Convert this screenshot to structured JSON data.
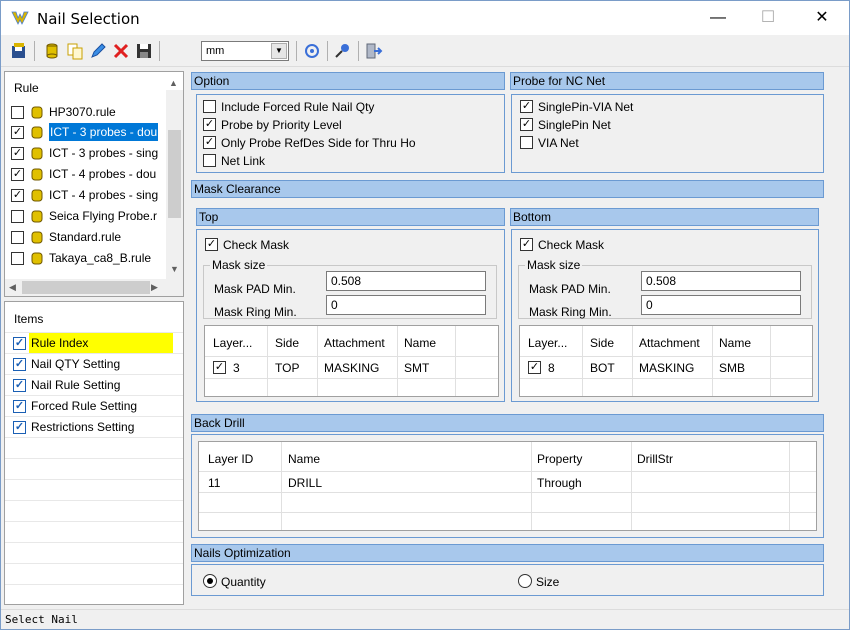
{
  "window": {
    "title": "Nail Selection",
    "minimize": "—",
    "maximize": "☐",
    "close": "✕"
  },
  "toolbar": {
    "unit_value": "mm"
  },
  "rule_panel": {
    "header": "Rule",
    "items": [
      {
        "label": "HP3070.rule",
        "checked": ""
      },
      {
        "label": "ICT - 3 probes - dou",
        "checked": "✓"
      },
      {
        "label": "ICT - 3 probes - sing",
        "checked": "✓"
      },
      {
        "label": "ICT - 4 probes - dou",
        "checked": "✓"
      },
      {
        "label": "ICT - 4 probes - sing",
        "checked": "✓"
      },
      {
        "label": "Seica Flying Probe.r",
        "checked": ""
      },
      {
        "label": "Standard.rule",
        "checked": ""
      },
      {
        "label": "Takaya_ca8_B.rule",
        "checked": ""
      }
    ]
  },
  "items_panel": {
    "header": "Items",
    "items": [
      {
        "label": "Rule Index",
        "checked": "✓"
      },
      {
        "label": "Nail QTY Setting",
        "checked": "✓"
      },
      {
        "label": "Nail Rule Setting",
        "checked": "✓"
      },
      {
        "label": "Forced Rule Setting",
        "checked": "✓"
      },
      {
        "label": "Restrictions Setting",
        "checked": "✓"
      }
    ]
  },
  "option": {
    "title": "Option",
    "items": [
      {
        "label": "Include Forced Rule Nail Qty",
        "checked": ""
      },
      {
        "label": "Probe by Priority Level",
        "checked": "✓"
      },
      {
        "label": "Only Probe RefDes Side for Thru Ho",
        "checked": "✓"
      },
      {
        "label": "Net Link",
        "checked": ""
      }
    ]
  },
  "probe_nc": {
    "title": "Probe for NC Net",
    "items": [
      {
        "label": "SinglePin-VIA Net",
        "checked": "✓"
      },
      {
        "label": "SinglePin Net",
        "checked": "✓"
      },
      {
        "label": "VIA Net",
        "checked": ""
      }
    ]
  },
  "mask": {
    "title": "Mask Clearance",
    "top": {
      "title": "Top",
      "check_mask": "Check Mask",
      "check_mask_checked": "✓",
      "mask_size": "Mask size",
      "pad_label": "Mask PAD Min.",
      "pad_value": "0.508",
      "ring_label": "Mask Ring Min.",
      "ring_value": "0",
      "columns": [
        "Layer...",
        "Side",
        "Attachment",
        "Name"
      ],
      "row": {
        "checked": "✓",
        "layer": "3",
        "side": "TOP",
        "attachment": "MASKING",
        "name": "SMT"
      }
    },
    "bottom": {
      "title": "Bottom",
      "check_mask": "Check Mask",
      "check_mask_checked": "✓",
      "mask_size": "Mask size",
      "pad_label": "Mask PAD Min.",
      "pad_value": "0.508",
      "ring_label": "Mask Ring Min.",
      "ring_value": "0",
      "columns": [
        "Layer...",
        "Side",
        "Attachment",
        "Name"
      ],
      "row": {
        "checked": "✓",
        "layer": "8",
        "side": "BOT",
        "attachment": "MASKING",
        "name": "SMB"
      }
    }
  },
  "back_drill": {
    "title": "Back Drill",
    "columns": [
      "Layer ID",
      "Name",
      "Property",
      "DrillStr"
    ],
    "row": {
      "layer_id": "11",
      "name": "DRILL",
      "property": "Through",
      "drillstr": ""
    }
  },
  "nails_opt": {
    "title": "Nails Optimization",
    "quantity": "Quantity",
    "size": "Size"
  },
  "status": {
    "text": "Select Nail"
  }
}
